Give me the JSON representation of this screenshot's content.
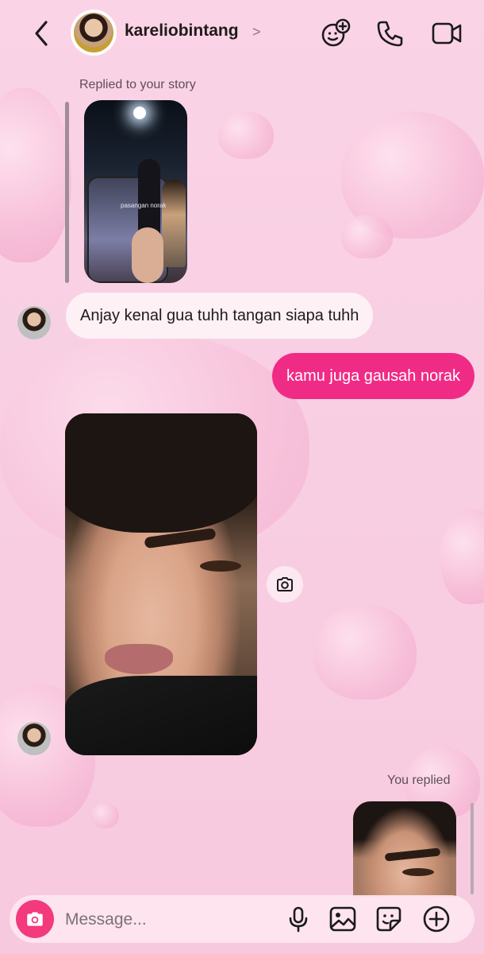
{
  "header": {
    "username": "kareliobintang",
    "username_chevron": ">",
    "icons": [
      "back-icon",
      "effects-add-icon",
      "phone-icon",
      "video-icon"
    ]
  },
  "thread": {
    "story_reply_label": "Replied to your story",
    "story_thumb_text": "pasangan norak",
    "incoming_message": "Anjay kenal gua tuhh tangan siapa tuhh",
    "outgoing_message": "kamu juga gausah norak",
    "you_replied_label": "You replied"
  },
  "composer": {
    "placeholder": "Message...",
    "icons": [
      "camera-icon",
      "microphone-icon",
      "gallery-icon",
      "sticker-icon",
      "add-icon"
    ]
  },
  "colors": {
    "accent": "#f02b86",
    "camera_button": "#f23a7c",
    "background": "#fbd3e6"
  }
}
